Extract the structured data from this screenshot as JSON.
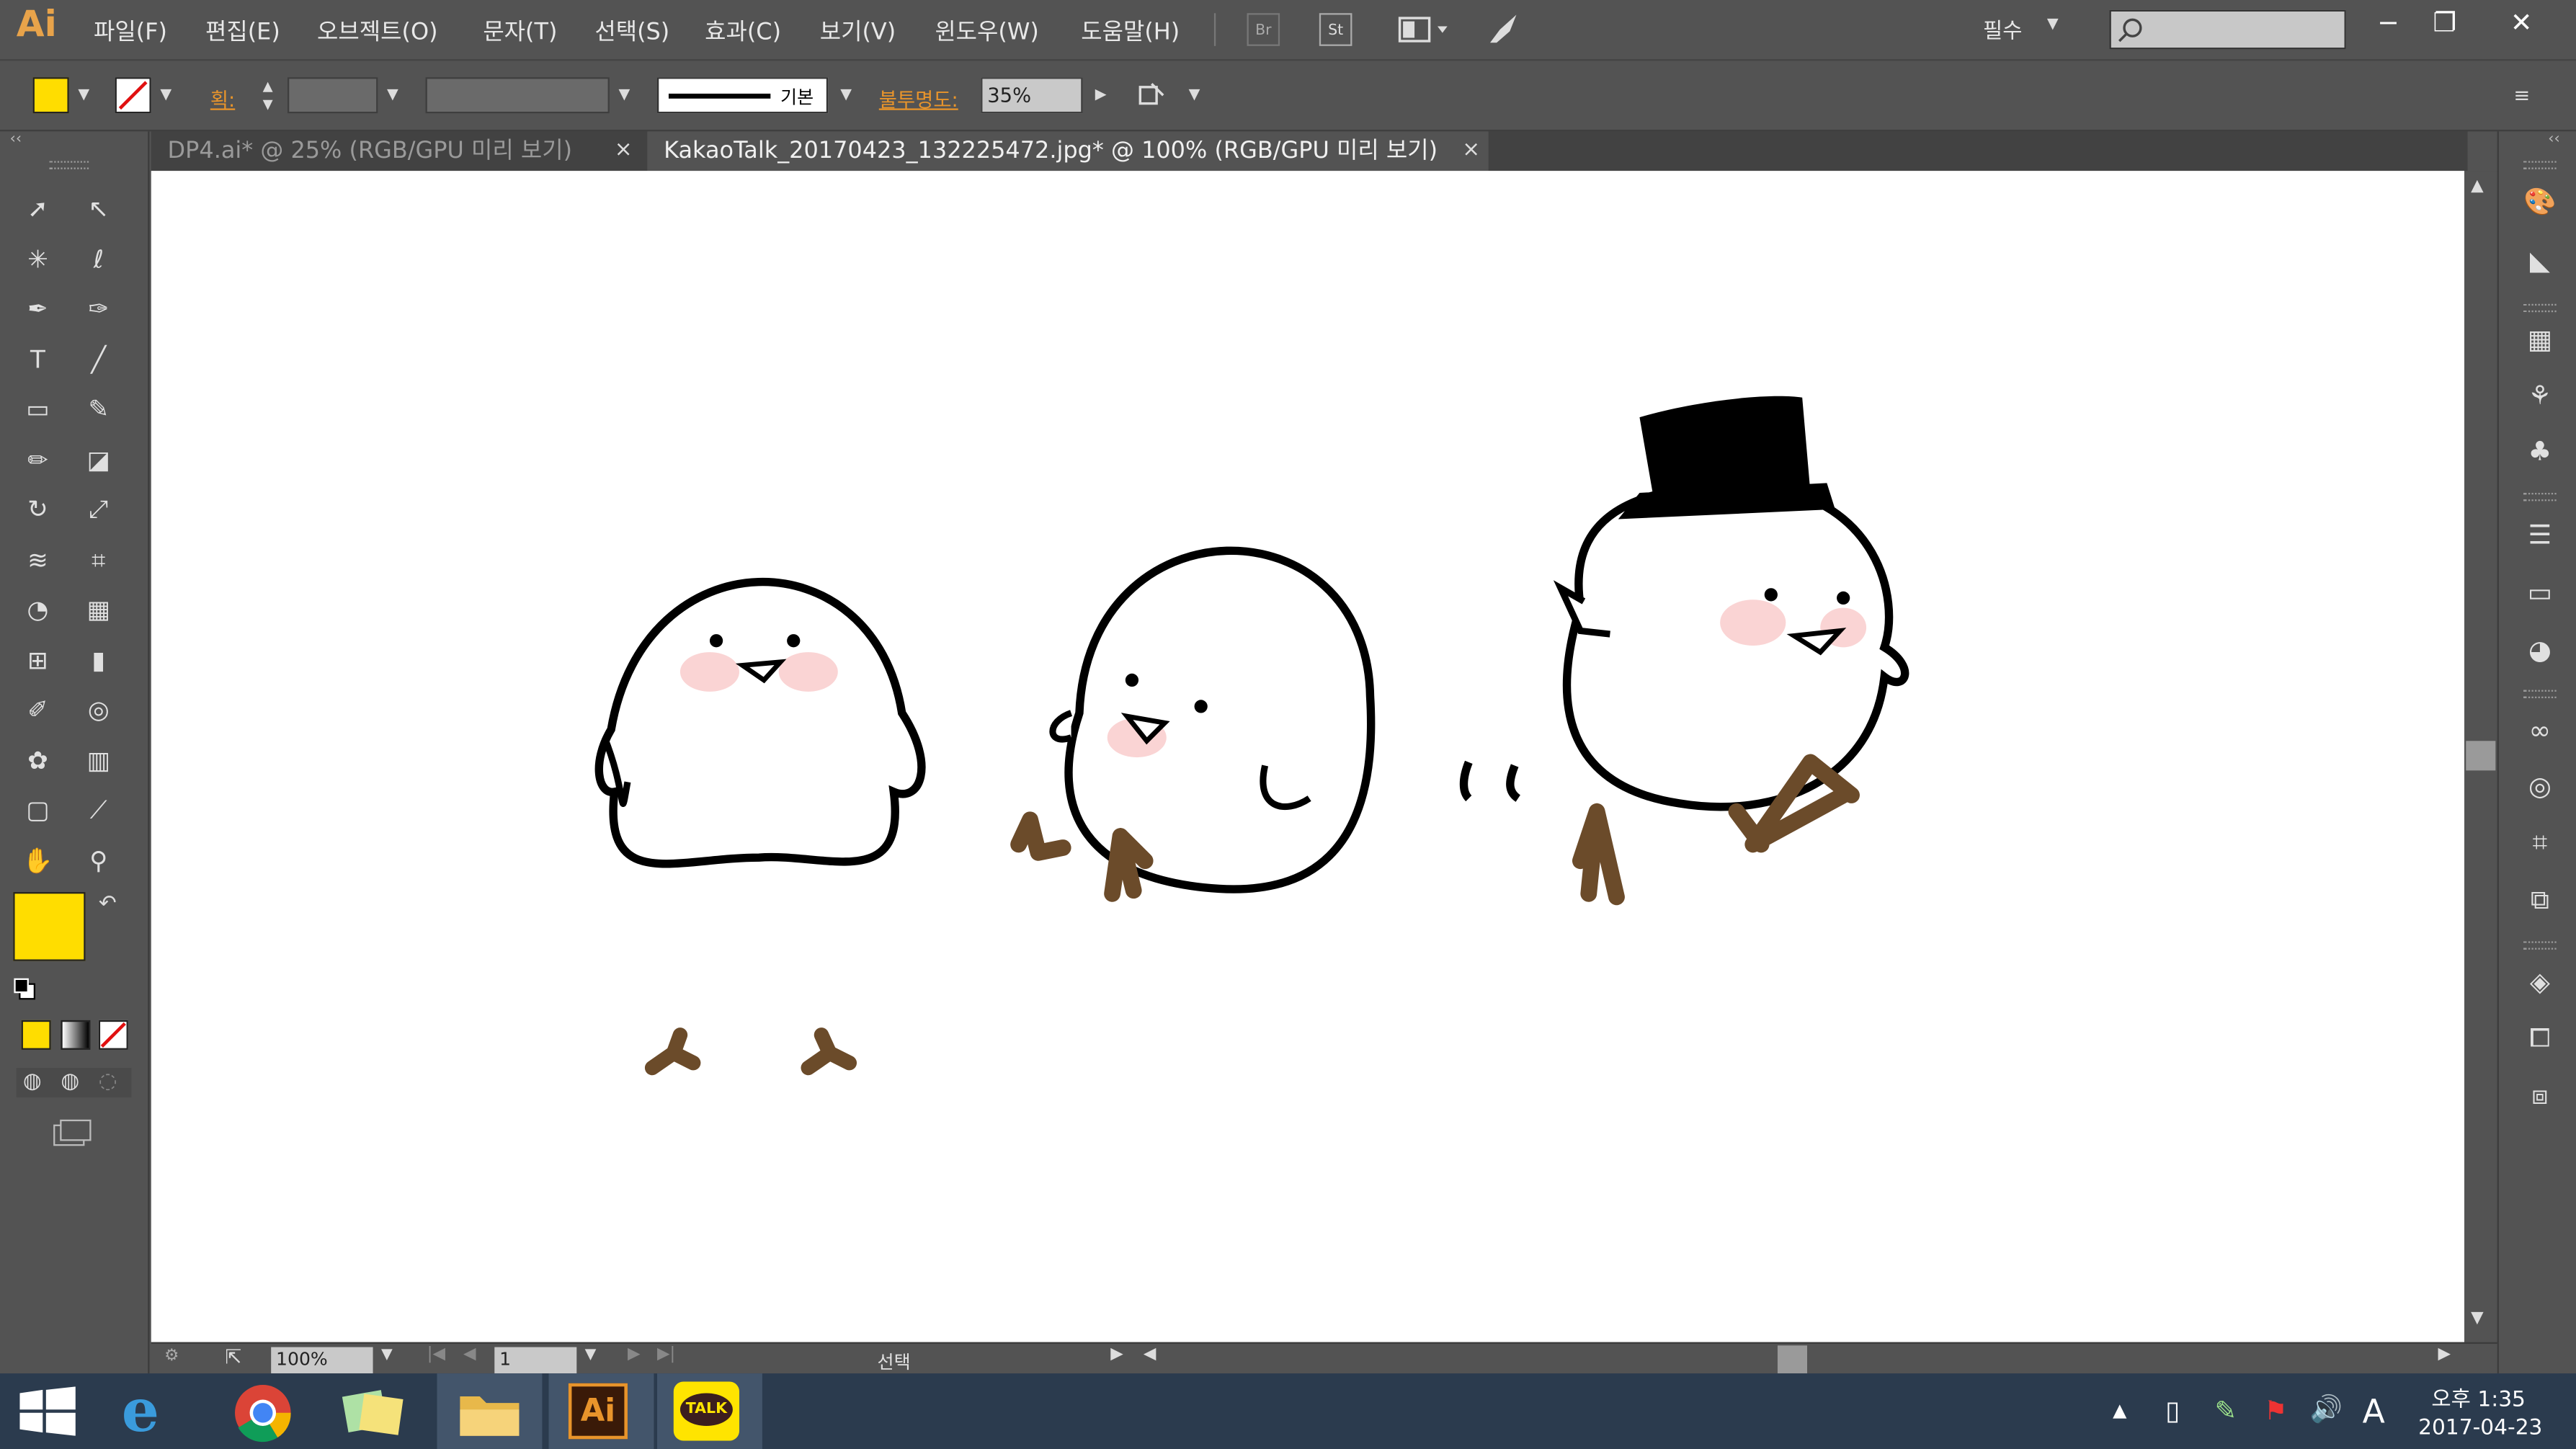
{
  "app": {
    "logo": "Ai"
  },
  "menu": [
    "파일(F)",
    "편집(E)",
    "오브젝트(O)",
    "문자(T)",
    "선택(S)",
    "효과(C)",
    "보기(V)",
    "윈도우(W)",
    "도움말(H)"
  ],
  "menubar_buttons": {
    "br": "Br",
    "st": "St"
  },
  "workspace": {
    "label": "필수"
  },
  "window_controls": {
    "minimize": "−",
    "restore": "❐",
    "close": "✕"
  },
  "control_bar": {
    "fill_color": "#ffdd00",
    "stroke_label": "획:",
    "stroke_style_label": "기본",
    "opacity_label": "불투명도:",
    "opacity_value": "35%"
  },
  "tabs": [
    {
      "label": "DP4.ai* @ 25% (RGB/GPU 미리 보기)",
      "active": false
    },
    {
      "label": "KakaoTalk_20170423_132225472.jpg* @ 100% (RGB/GPU 미리 보기)",
      "active": true
    }
  ],
  "tab_close": "×",
  "status": {
    "zoom": "100%",
    "artboard": "1",
    "tool_label": "선택"
  },
  "tools_left": [
    "selection-tool",
    "direct-selection-tool",
    "magic-wand-tool",
    "lasso-tool",
    "pen-tool",
    "curvature-tool",
    "type-tool",
    "line-tool",
    "rectangle-tool",
    "paintbrush-tool",
    "pencil-tool",
    "eraser-tool",
    "rotate-tool",
    "scale-tool",
    "width-tool",
    "free-transform-tool",
    "shape-builder-tool",
    "perspective-grid-tool",
    "mesh-tool",
    "gradient-tool",
    "eyedropper-tool",
    "blend-tool",
    "symbol-sprayer-tool",
    "column-graph-tool",
    "artboard-tool",
    "slice-tool",
    "hand-tool",
    "zoom-tool"
  ],
  "tool_glyphs": [
    "➚",
    "↖",
    "✳",
    "ℓ",
    "✒",
    "✑",
    "T",
    "╱",
    "▭",
    "✎",
    "✏",
    "◪",
    "↻",
    "⤢",
    "≋",
    "⌗",
    "◔",
    "▦",
    "⊞",
    "▮",
    "✐",
    "◎",
    "✿",
    "▥",
    "▢",
    "⟋",
    "✋",
    "⚲"
  ],
  "colors": {
    "fill": "#ffdd00",
    "stroke": "none",
    "accent": "#e8942b",
    "chick_feet": "#6b4b2a",
    "blush": "#f7b7b7"
  },
  "right_panel_icons": [
    "color-icon",
    "color-guide-icon",
    "swatches-icon",
    "brushes-icon",
    "symbols-icon",
    "stroke-icon",
    "gradient-icon",
    "transparency-icon",
    "cc-libraries-icon",
    "appearance-icon",
    "transform-icon",
    "align-icon",
    "layers-icon",
    "artboards-icon",
    "pathfinder-icon"
  ],
  "taskbar": {
    "apps": [
      "start-icon",
      "internet-explorer-icon",
      "chrome-icon",
      "sticky-notes-icon",
      "file-explorer-icon",
      "illustrator-icon",
      "kakaotalk-icon"
    ],
    "ai_label": "Ai",
    "talk_label": "TALK",
    "ime": "A",
    "time": "오후 1:35",
    "date": "2017-04-23"
  }
}
